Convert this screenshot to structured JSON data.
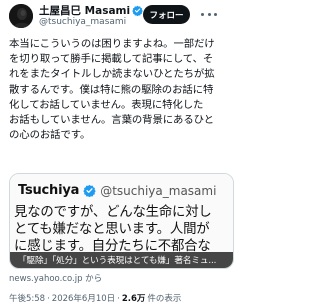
{
  "author": {
    "display_name": "土屋昌巳 Masami",
    "handle": "@tsuchiya_masami",
    "follow_label": "フォロー"
  },
  "tweet": {
    "lines": [
      "本当にこういうのは困りますよね。一部だけ",
      "を切り取って勝手に掲載して記事にして、そ",
      "れをまたタイトルしか読まないひとたちが拡",
      "散するんです。僕は特に熊の駆除のお話に特",
      "化してお話していません。表現に特化した",
      "お話もしていません。言葉の背景にあるひと",
      "の心のお話です。"
    ]
  },
  "link_card": {
    "quote_name": "Tsuchiya",
    "quote_handle": "@tsuchiya_masami",
    "quote_lines": [
      "見なのですが、どんな生命に対し",
      "とても嫌だなと思います。人間が",
      "に感じます。自分たちに不都合な"
    ],
    "caption": "「駆除」「処分」という表現はとても嫌」著名ミュ..."
  },
  "source": "news.yahoo.co.jp から",
  "meta": {
    "time": "午後5:58",
    "date": "2026年6月10日",
    "views_count": "2.6万",
    "views_label": "件の表示",
    "separator": "·"
  },
  "colors": {
    "verified": "#1d9bf0",
    "follow_bg": "#0f1419",
    "secondary_text": "#536471"
  },
  "icons": [
    "verified-badge-icon",
    "more-options-icon"
  ]
}
